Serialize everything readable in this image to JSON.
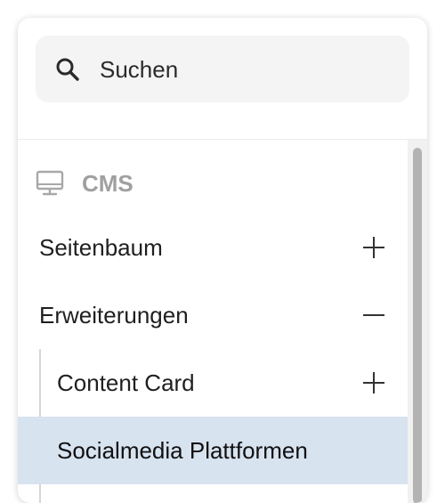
{
  "search": {
    "placeholder": "Suchen",
    "icon": "search-icon"
  },
  "section": {
    "label": "CMS",
    "icon": "monitor-icon"
  },
  "nav": {
    "items": [
      {
        "label": "Seitenbaum",
        "toggle": "+",
        "state": "collapsed"
      },
      {
        "label": "Erweiterungen",
        "toggle": "−",
        "state": "expanded"
      },
      {
        "label": "Content Card",
        "toggle": "+",
        "state": "collapsed"
      },
      {
        "label": "Socialmedia Plattformen",
        "state": "selected"
      }
    ]
  },
  "colors": {
    "selected_background": "#d8e3f0",
    "section_label": "#a0a0a0",
    "search_background": "#f4f4f4"
  }
}
